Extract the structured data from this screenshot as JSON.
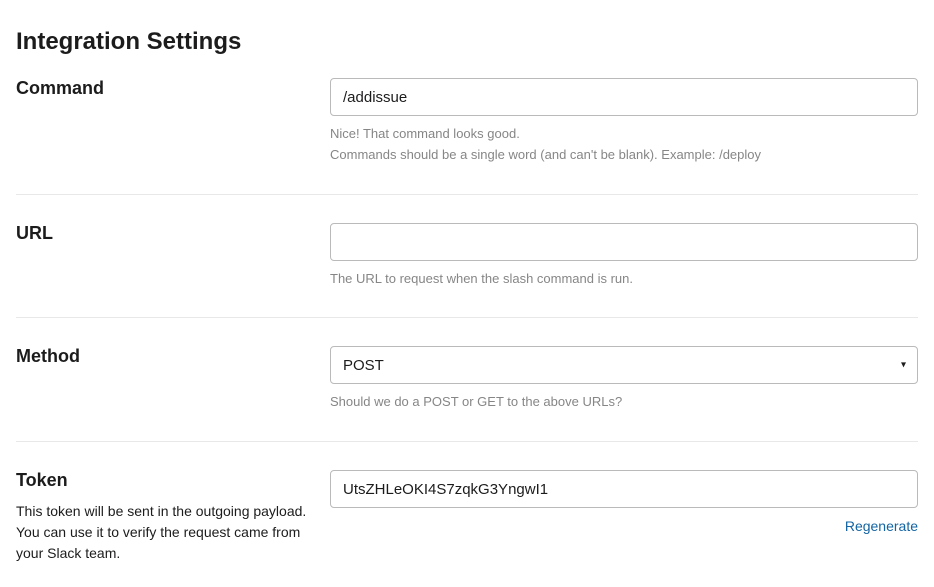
{
  "page_title": "Integration Settings",
  "command": {
    "label": "Command",
    "value": "/addissue",
    "help1": "Nice! That command looks good.",
    "help2": "Commands should be a single word (and can't be blank). Example: /deploy"
  },
  "url": {
    "label": "URL",
    "value": "",
    "help": "The URL to request when the slash command is run."
  },
  "method": {
    "label": "Method",
    "value": "POST",
    "help": "Should we do a POST or GET to the above URLs?"
  },
  "token": {
    "label": "Token",
    "desc": "This token will be sent in the outgoing payload. You can use it to verify the request came from your Slack team.",
    "value": "UtsZHLeOKI4S7zqkG3YngwI1",
    "regenerate": "Regenerate"
  }
}
